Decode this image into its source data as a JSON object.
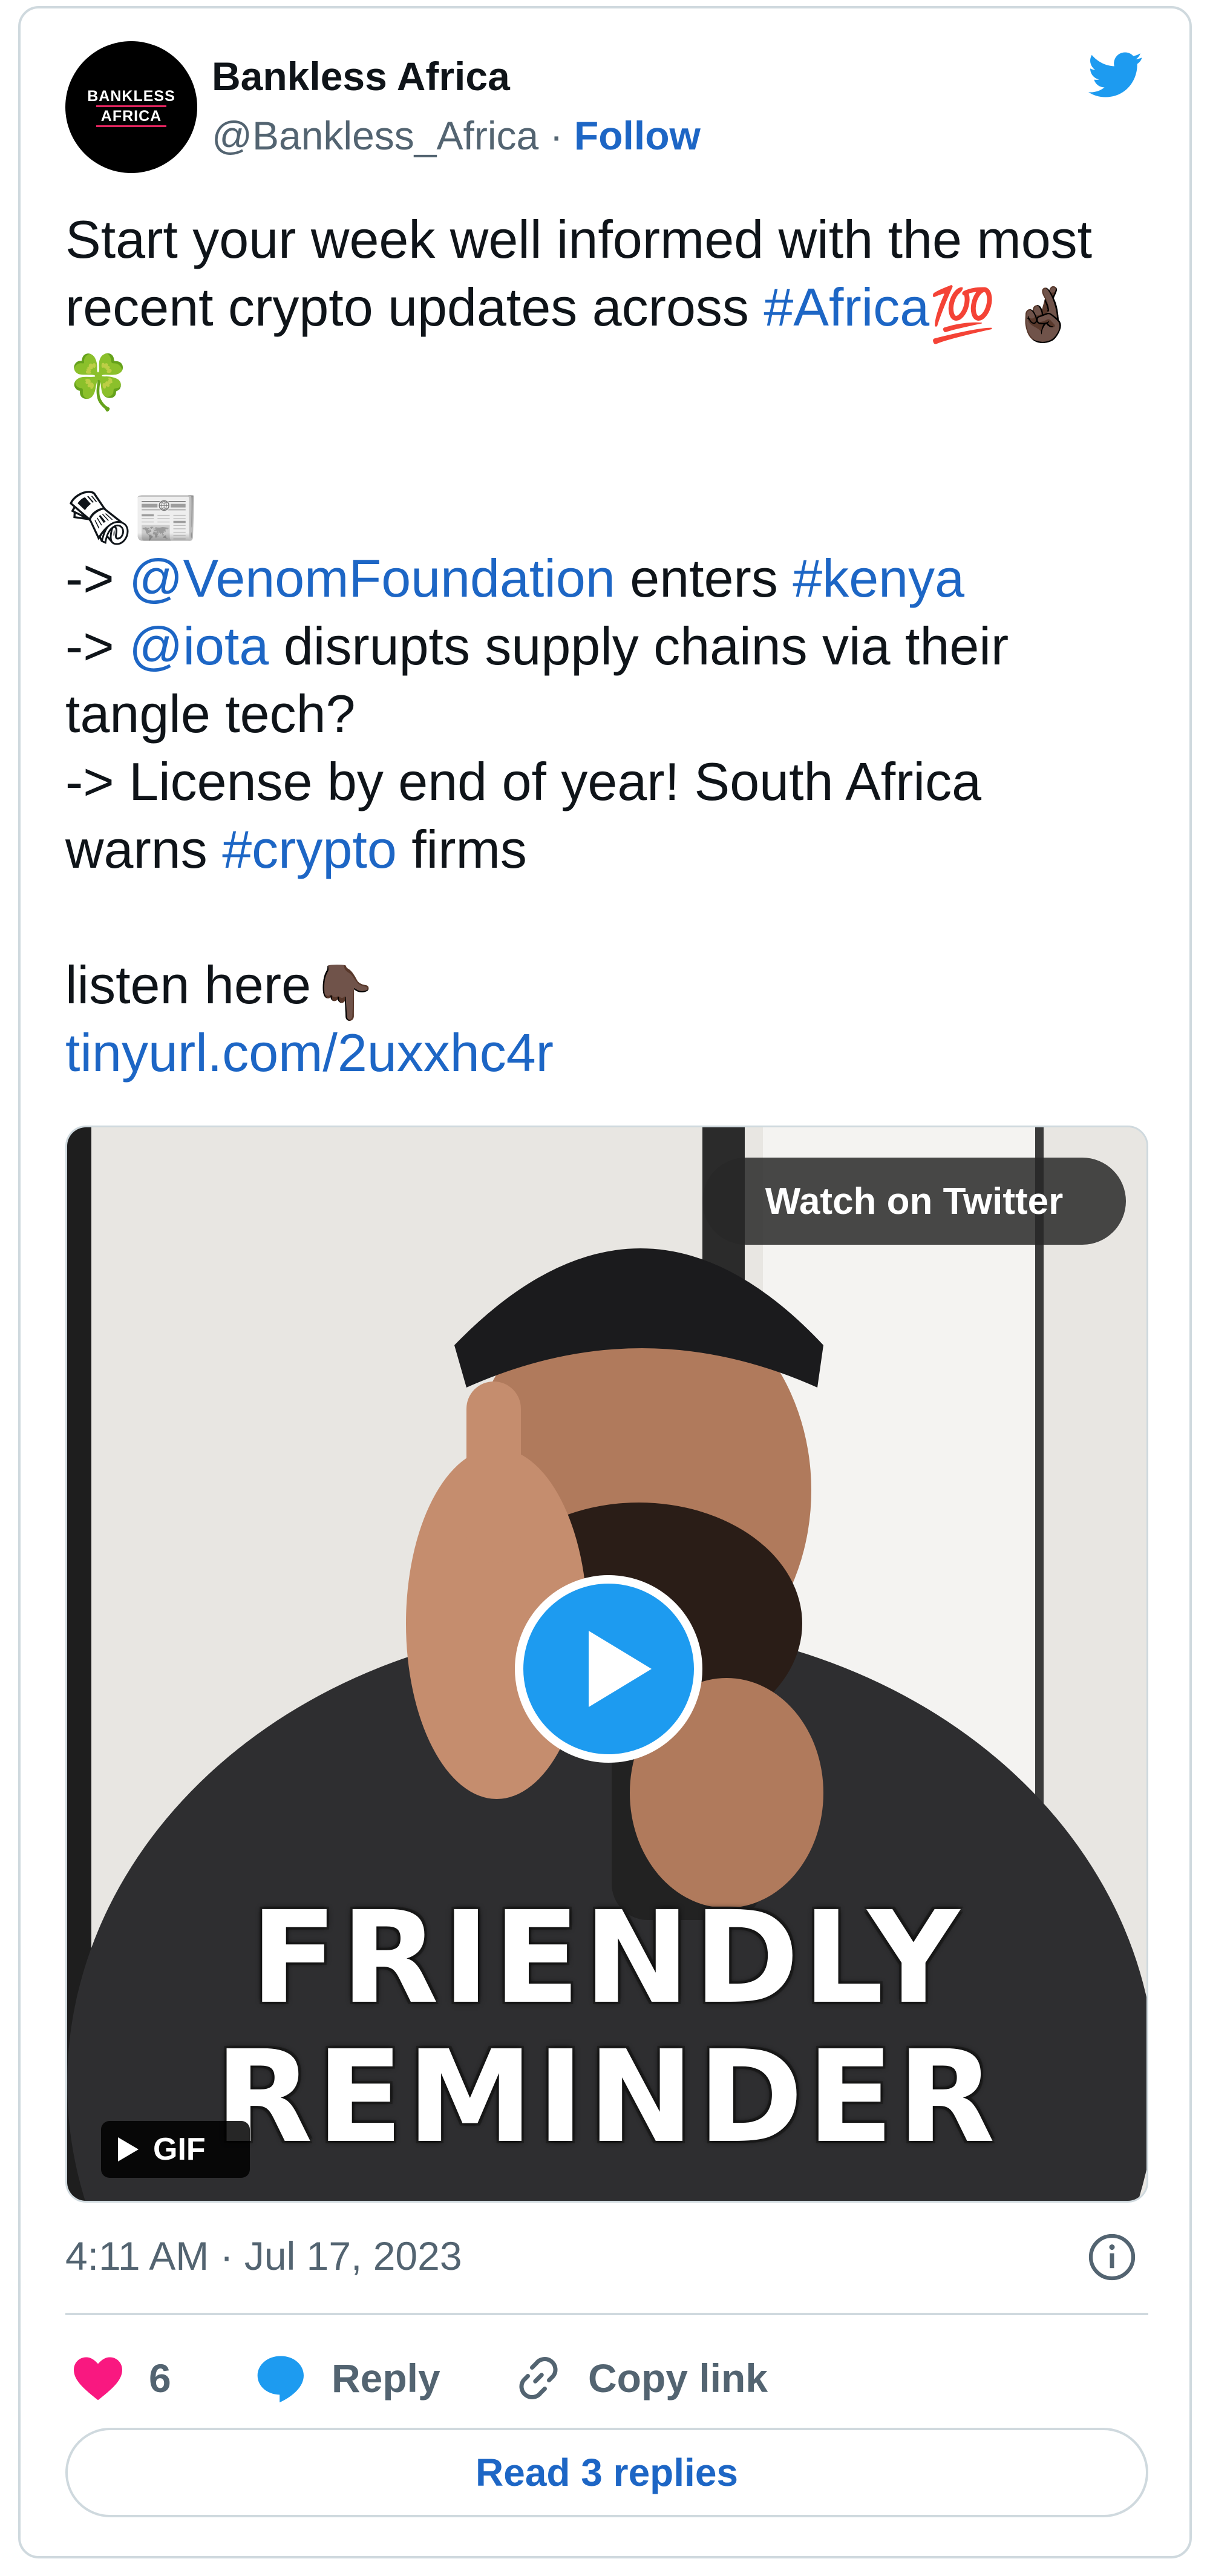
{
  "author": {
    "avatar_line1": "BANKLESS",
    "avatar_line2": "AFRICA",
    "name": "Bankless Africa",
    "handle": "@Bankless_Africa",
    "separator": "·",
    "follow_label": "Follow"
  },
  "tweet": {
    "line1": "Start your week well informed with the most",
    "line2_text": "recent crypto updates across ",
    "line2_hashtag": "#Africa",
    "line6_prefix": "-> ",
    "line6_mention": "@VenomFoundation",
    "line6_mid": " enters ",
    "line6_hashtag": "#kenya",
    "line7_prefix": "-> ",
    "line7_mention": "@iota",
    "line7_rest": " disrupts supply chains via their",
    "line8": "tangle tech?",
    "line9": "-> License by end of year! South Africa",
    "line10_text": "warns ",
    "line10_hashtag": "#crypto",
    "line10_rest": " firms",
    "line12": "listen here",
    "link": "tinyurl.com/2uxxhc4r",
    "emoji_100": "💯",
    "emoji_crossed_fingers": "🤞🏿",
    "emoji_clover": "🍀",
    "emoji_rolled_newspaper": "🗞",
    "emoji_newspaper": "📰",
    "emoji_point_down": "👇🏿"
  },
  "media": {
    "watch_label": "Watch on Twitter",
    "caption_line1": "FRIENDLY",
    "caption_line2": "REMINDER",
    "gif_label": "GIF"
  },
  "meta": {
    "timestamp": "4:11 AM · Jul 17, 2023"
  },
  "actions": {
    "like_count": "6",
    "reply_label": "Reply",
    "copy_label": "Copy link",
    "read_replies_label": "Read 3 replies"
  },
  "colors": {
    "link": "#1d66c5",
    "twitter_blue": "#1d9bf0",
    "heart": "#f91880",
    "muted": "#536471",
    "border": "#cfd9de"
  }
}
